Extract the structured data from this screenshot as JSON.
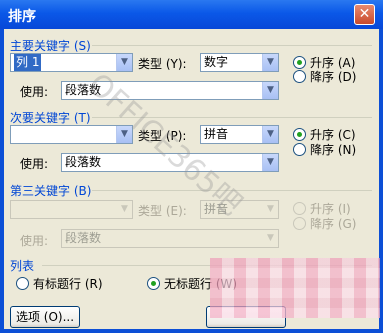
{
  "window": {
    "title": "排序",
    "close_icon": "close-icon"
  },
  "primary": {
    "section_label": "主要关键字 (S)",
    "key_value": "列 1",
    "type_label": "类型 (Y):",
    "type_value": "数字",
    "using_label": "使用:",
    "using_value": "段落数",
    "asc_label": "升序 (A)",
    "desc_label": "降序 (D)"
  },
  "secondary": {
    "section_label": "次要关键字 (T)",
    "key_value": "",
    "type_label": "类型 (P):",
    "type_value": "拼音",
    "using_label": "使用:",
    "using_value": "段落数",
    "asc_label": "升序 (C)",
    "desc_label": "降序 (N)"
  },
  "third": {
    "section_label": "第三关键字 (B)",
    "key_value": "",
    "type_label": "类型 (E):",
    "type_value": "拼音",
    "using_label": "使用:",
    "using_value": "段落数",
    "asc_label": "升序 (I)",
    "desc_label": "降序 (G)"
  },
  "list": {
    "section_label": "列表",
    "has_header_label": "有标题行 (R)",
    "no_header_label": "无标题行 (W)",
    "selected": "no_header"
  },
  "buttons": {
    "options_label": "选项 (O)..."
  },
  "watermark": {
    "text": "OFFICE365吧"
  },
  "colors": {
    "title_bar": "#0a58e8",
    "dialog_bg": "#ece9d8",
    "section_text": "#0046d5",
    "selection": "#316ac5"
  }
}
